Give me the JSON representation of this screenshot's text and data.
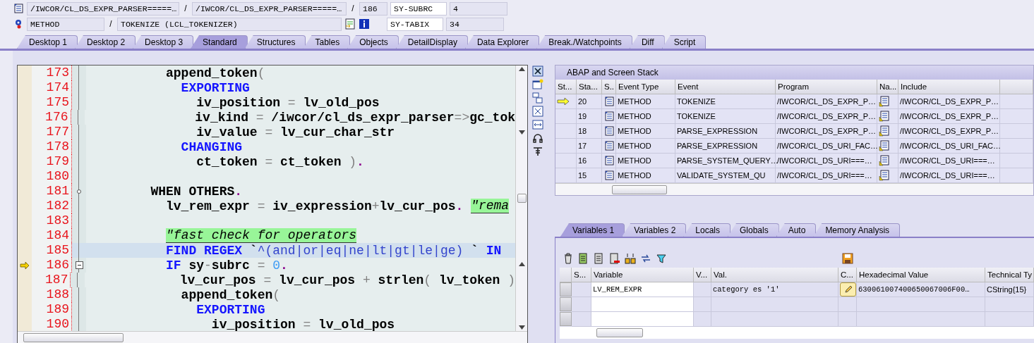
{
  "header": {
    "row_1": [
      {
        "kind": "field",
        "text": "/IWCOR/CL_DS_EXPR_PARSER=====…"
      },
      {
        "kind": "sep",
        "text": "/"
      },
      {
        "kind": "field",
        "text": "/IWCOR/CL_DS_EXPR_PARSER=====…"
      },
      {
        "kind": "sep",
        "text": "/"
      },
      {
        "kind": "field",
        "text": "186"
      }
    ],
    "row_2": [
      {
        "kind": "field",
        "text": "METHOD"
      },
      {
        "kind": "sep",
        "text": "/"
      },
      {
        "kind": "field",
        "text": "TOKENIZE (LCL_TOKENIZER)"
      }
    ],
    "system_fields": [
      {
        "name": "SY-SUBRC",
        "value": "4"
      },
      {
        "name": "SY-TABIX",
        "value": "34"
      }
    ]
  },
  "tabs": [
    {
      "label": "Desktop 1",
      "selected": false
    },
    {
      "label": "Desktop 2",
      "selected": false
    },
    {
      "label": "Desktop 3",
      "selected": false
    },
    {
      "label": "Standard",
      "selected": true
    },
    {
      "label": "Structures",
      "selected": false
    },
    {
      "label": "Tables",
      "selected": false
    },
    {
      "label": "Objects",
      "selected": false
    },
    {
      "label": "DetailDisplay",
      "selected": false
    },
    {
      "label": "Data Explorer",
      "selected": false
    },
    {
      "label": "Break./Watchpoints",
      "selected": false
    },
    {
      "label": "Diff",
      "selected": false
    },
    {
      "label": "Script",
      "selected": false
    }
  ],
  "code": {
    "lines": [
      {
        "number": "173",
        "current": false,
        "cursor": false,
        "branch_node": false,
        "collapsible": false,
        "tokens": [
          {
            "kind": "id",
            "text": "          append_token"
          },
          {
            "kind": "op",
            "text": "("
          }
        ]
      },
      {
        "number": "174",
        "current": false,
        "cursor": false,
        "branch_node": false,
        "collapsible": false,
        "tokens": [
          {
            "kind": "kw",
            "text": "            EXPORTING"
          }
        ]
      },
      {
        "number": "175",
        "current": false,
        "cursor": false,
        "branch_node": false,
        "collapsible": false,
        "tokens": [
          {
            "kind": "id",
            "text": "              iv_position "
          },
          {
            "kind": "op",
            "text": "="
          },
          {
            "kind": "id",
            "text": " lv_old_pos"
          }
        ]
      },
      {
        "number": "176",
        "current": false,
        "cursor": false,
        "branch_node": false,
        "collapsible": false,
        "tokens": [
          {
            "kind": "id",
            "text": "              iv_kind "
          },
          {
            "kind": "op",
            "text": "="
          },
          {
            "kind": "id",
            "text": " /iwcor/cl_ds_expr_parser"
          },
          {
            "kind": "op",
            "text": "=>"
          },
          {
            "kind": "id",
            "text": "gc_tok"
          }
        ]
      },
      {
        "number": "177",
        "current": false,
        "cursor": false,
        "branch_node": false,
        "collapsible": false,
        "tokens": [
          {
            "kind": "id",
            "text": "              iv_value "
          },
          {
            "kind": "op",
            "text": "="
          },
          {
            "kind": "id",
            "text": " lv_cur_char_str"
          }
        ]
      },
      {
        "number": "178",
        "current": false,
        "cursor": false,
        "branch_node": false,
        "collapsible": false,
        "tokens": [
          {
            "kind": "kw",
            "text": "            CHANGING"
          }
        ]
      },
      {
        "number": "179",
        "current": false,
        "cursor": false,
        "branch_node": false,
        "collapsible": false,
        "tokens": [
          {
            "kind": "id",
            "text": "              ct_token "
          },
          {
            "kind": "op",
            "text": "="
          },
          {
            "kind": "id",
            "text": " ct_token "
          },
          {
            "kind": "op",
            "text": ")"
          },
          {
            "kind": "dot",
            "text": "."
          }
        ]
      },
      {
        "number": "180",
        "current": false,
        "cursor": false,
        "branch_node": false,
        "collapsible": false
      },
      {
        "number": "181",
        "current": false,
        "cursor": false,
        "branch_node": true,
        "collapsible": false,
        "tokens": [
          {
            "kind": "id",
            "text": "        WHEN OTHERS"
          },
          {
            "kind": "dot",
            "text": "."
          }
        ]
      },
      {
        "number": "182",
        "current": false,
        "cursor": false,
        "branch_node": false,
        "collapsible": false,
        "tokens": [
          {
            "kind": "id",
            "text": "          lv_rem_expr "
          },
          {
            "kind": "op",
            "text": "="
          },
          {
            "kind": "id",
            "text": " iv_expression"
          },
          {
            "kind": "op",
            "text": "+"
          },
          {
            "kind": "id",
            "text": "lv_cur_pos"
          },
          {
            "kind": "dot",
            "text": ". "
          },
          {
            "kind": "cmt",
            "text": "\"rema"
          }
        ]
      },
      {
        "number": "183",
        "current": false,
        "cursor": false,
        "branch_node": false,
        "collapsible": false
      },
      {
        "number": "184",
        "current": false,
        "cursor": false,
        "branch_node": false,
        "collapsible": false,
        "tokens": [
          {
            "kind": "cmt",
            "text": "          \"fast check for operators"
          }
        ]
      },
      {
        "number": "185",
        "current": false,
        "cursor": true,
        "branch_node": false,
        "collapsible": false,
        "tokens": [
          {
            "kind": "kw",
            "text": "          FIND REGEX "
          },
          {
            "kind": "id",
            "text": "`"
          },
          {
            "kind": "str",
            "text": "^(and|or|eq|ne|lt|gt|le|ge) "
          },
          {
            "kind": "id",
            "text": "`"
          },
          {
            "kind": "kw",
            "text": " IN"
          }
        ]
      },
      {
        "number": "186",
        "current": true,
        "cursor": false,
        "branch_node": false,
        "collapsible": true,
        "tokens": [
          {
            "kind": "kw",
            "text": "          IF "
          },
          {
            "kind": "id",
            "text": "sy"
          },
          {
            "kind": "op",
            "text": "-"
          },
          {
            "kind": "id",
            "text": "subrc "
          },
          {
            "kind": "op",
            "text": "="
          },
          {
            "kind": "num",
            "text": " 0"
          },
          {
            "kind": "dot",
            "text": "."
          }
        ]
      },
      {
        "number": "187",
        "current": false,
        "cursor": false,
        "branch_node": false,
        "collapsible": false,
        "tokens": [
          {
            "kind": "id",
            "text": "            lv_cur_pos "
          },
          {
            "kind": "op",
            "text": "="
          },
          {
            "kind": "id",
            "text": " lv_cur_pos "
          },
          {
            "kind": "op",
            "text": "+"
          },
          {
            "kind": "id",
            "text": " strlen"
          },
          {
            "kind": "op",
            "text": "("
          },
          {
            "kind": "id",
            "text": " lv_token "
          },
          {
            "kind": "op",
            "text": ")"
          }
        ]
      },
      {
        "number": "188",
        "current": false,
        "cursor": false,
        "branch_node": false,
        "collapsible": false,
        "tokens": [
          {
            "kind": "id",
            "text": "            append_token"
          },
          {
            "kind": "op",
            "text": "("
          }
        ]
      },
      {
        "number": "189",
        "current": false,
        "cursor": false,
        "branch_node": false,
        "collapsible": false,
        "tokens": [
          {
            "kind": "kw",
            "text": "              EXPORTING"
          }
        ]
      },
      {
        "number": "190",
        "current": false,
        "cursor": false,
        "branch_node": false,
        "collapsible": false,
        "tokens": [
          {
            "kind": "id",
            "text": "                iv_position "
          },
          {
            "kind": "op",
            "text": "="
          },
          {
            "kind": "id",
            "text": " lv_old_pos"
          }
        ]
      }
    ]
  },
  "stack": {
    "title": "ABAP and Screen Stack",
    "columns": [
      "St...",
      "Sta...",
      "S..",
      "Event Type",
      "Event",
      "Program",
      "Na...",
      "Include"
    ],
    "rows": [
      {
        "current": true,
        "level": "20",
        "event_type": "METHOD",
        "event": "TOKENIZE",
        "program": "/IWCOR/CL_DS_EXPR_P…",
        "include": "/IWCOR/CL_DS_EXPR_P…"
      },
      {
        "current": false,
        "level": "19",
        "event_type": "METHOD",
        "event": "TOKENIZE",
        "program": "/IWCOR/CL_DS_EXPR_P…",
        "include": "/IWCOR/CL_DS_EXPR_P…"
      },
      {
        "current": false,
        "level": "18",
        "event_type": "METHOD",
        "event": "PARSE_EXPRESSION",
        "program": "/IWCOR/CL_DS_EXPR_P…",
        "include": "/IWCOR/CL_DS_EXPR_P…"
      },
      {
        "current": false,
        "level": "17",
        "event_type": "METHOD",
        "event": "PARSE_EXPRESSION",
        "program": "/IWCOR/CL_DS_URI_FAC…",
        "include": "/IWCOR/CL_DS_URI_FAC…"
      },
      {
        "current": false,
        "level": "16",
        "event_type": "METHOD",
        "event": "PARSE_SYSTEM_QUERY…",
        "program": "/IWCOR/CL_DS_URI===…",
        "include": "/IWCOR/CL_DS_URI===…"
      },
      {
        "current": false,
        "level": "15",
        "event_type": "METHOD",
        "event": "VALIDATE_SYSTEM_QU",
        "program": "/IWCOR/CL_DS_URI===…",
        "include": "/IWCOR/CL_DS_URI===…"
      }
    ]
  },
  "variable_tabs": [
    {
      "label": "Variables 1",
      "selected": true
    },
    {
      "label": "Variables 2",
      "selected": false
    },
    {
      "label": "Locals",
      "selected": false
    },
    {
      "label": "Globals",
      "selected": false
    },
    {
      "label": "Auto",
      "selected": false
    },
    {
      "label": "Memory Analysis",
      "selected": false
    }
  ],
  "variables": {
    "columns": [
      "S...",
      "Variable",
      "V...",
      "Val.",
      "C...",
      "Hexadecimal Value",
      "Technical Ty"
    ],
    "rows": [
      {
        "variable": "LV_REM_EXPR",
        "value": "category es '1'",
        "hex": "630061007400650067006F00…",
        "type": "CString{15}"
      },
      {},
      {}
    ]
  }
}
